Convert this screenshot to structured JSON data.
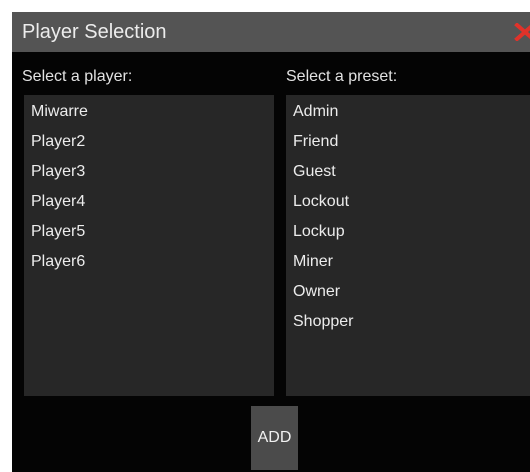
{
  "window": {
    "title": "Player Selection"
  },
  "players": {
    "label": "Select a player:",
    "items": [
      "Miwarre",
      "Player2",
      "Player3",
      "Player4",
      "Player5",
      "Player6"
    ]
  },
  "presets": {
    "label": "Select a preset:",
    "items": [
      "Admin",
      "Friend",
      "Guest",
      "Lockout",
      "Lockup",
      "Miner",
      "Owner",
      "Shopper"
    ]
  },
  "actions": {
    "add_label": "ADD"
  },
  "icons": {
    "close": "close-icon"
  },
  "colors": {
    "titlebar": "#545454",
    "window_bg": "#040404",
    "list_bg": "#272727",
    "button_bg": "#4b4b4b",
    "close_icon": "#e0322a"
  }
}
